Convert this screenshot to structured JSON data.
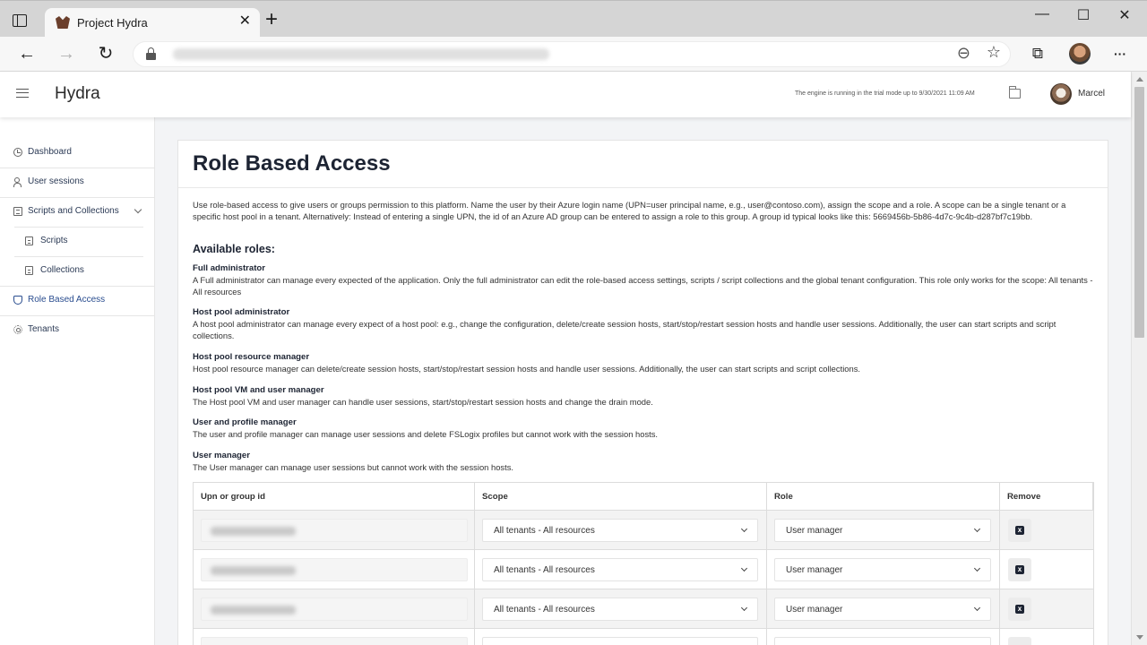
{
  "browser": {
    "tab_title": "Project Hydra",
    "tab_close": "✕",
    "new_tab": "+",
    "window_controls": {
      "minimize": "—",
      "maximize": "☐",
      "close": "✕"
    },
    "toolbar": {
      "back": "←",
      "forward": "→",
      "refresh": "↻",
      "zoom_icon": "zoom-out-icon",
      "favorites": "☆",
      "collections": "⧉",
      "more": "···"
    }
  },
  "header": {
    "app_title": "Hydra",
    "trial_note": "The engine is running in the trial mode up to 9/30/2021 11:09 AM",
    "user_name": "Marcel"
  },
  "sidebar": {
    "items": [
      {
        "label": "Dashboard",
        "icon": "clock-icon"
      },
      {
        "label": "User sessions",
        "icon": "users-icon"
      },
      {
        "label": "Scripts and Collections",
        "icon": "list-icon"
      },
      {
        "label": "Scripts",
        "icon": "document-icon"
      },
      {
        "label": "Collections",
        "icon": "document-icon"
      },
      {
        "label": "Role Based Access",
        "icon": "shield-icon"
      },
      {
        "label": "Tenants",
        "icon": "gear-icon"
      }
    ],
    "active_color": "#2a4d8f"
  },
  "page": {
    "title": "Role Based Access",
    "intro": "Use role-based access to give users or groups permission to this platform. Name the user by their Azure login name (UPN=user principal name, e.g., user@contoso.com), assign the scope and a role. A scope can be a single tenant or a specific host pool in a tenant. Alternatively: Instead of entering a single UPN, the id of an Azure AD group can be entered to assign a role to this group. A group id typical looks like this: 5669456b-5b86-4d7c-9c4b-d287bf7c19bb.",
    "available_roles_heading": "Available roles:",
    "roles": [
      {
        "name": "Full administrator",
        "description": "A Full administrator can manage every expected of the application. Only the full administrator can edit the role-based access settings, scripts / script collections and the global tenant configuration. This role only works for the scope: All tenants - All resources"
      },
      {
        "name": "Host pool administrator",
        "description": "A host pool administrator can manage every expect of a host pool: e.g., change the configuration, delete/create session hosts, start/stop/restart session hosts and handle user sessions. Additionally, the user can start scripts and script collections."
      },
      {
        "name": "Host pool resource manager",
        "description": "Host pool resource manager can delete/create session hosts, start/stop/restart session hosts and handle user sessions. Additionally, the user can start scripts and script collections."
      },
      {
        "name": "Host pool VM and user manager",
        "description": "The Host pool VM and user manager can handle user sessions, start/stop/restart session hosts and change the drain mode."
      },
      {
        "name": "User and profile manager",
        "description": "The user and profile manager can manage user sessions and delete FSLogix profiles but cannot work with the session hosts."
      },
      {
        "name": "User manager",
        "description": "The User manager can manage user sessions but cannot work with the session hosts."
      }
    ],
    "table": {
      "headers": [
        "Upn or group id",
        "Scope",
        "Role",
        "Remove"
      ],
      "rows": [
        {
          "scope": "All tenants - All resources",
          "role": "User manager",
          "remove": "x"
        },
        {
          "scope": "All tenants - All resources",
          "role": "User manager",
          "remove": "x"
        },
        {
          "scope": "All tenants - All resources",
          "role": "User manager",
          "remove": "x"
        }
      ]
    }
  }
}
